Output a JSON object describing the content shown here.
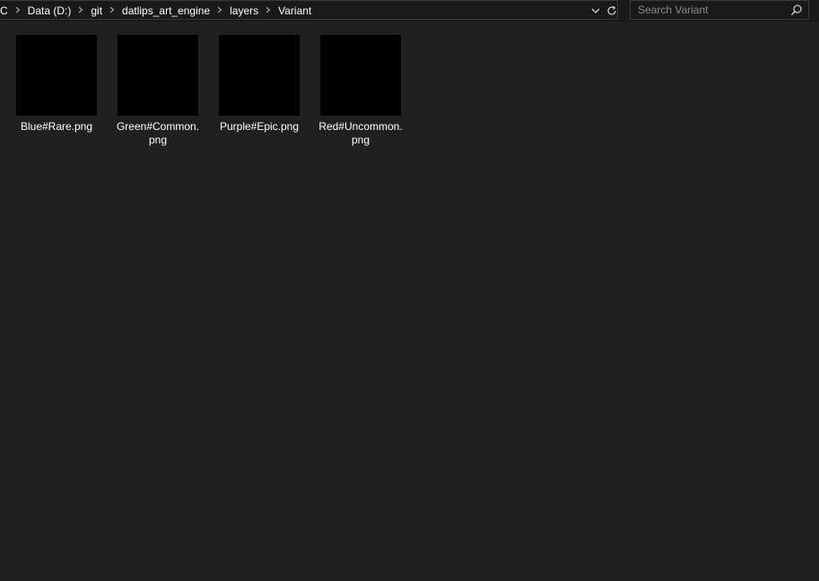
{
  "address": {
    "crumbs": [
      "C",
      "Data (D:)",
      "git",
      "datlips_art_engine",
      "layers",
      "Variant"
    ]
  },
  "search": {
    "placeholder": "Search Variant",
    "value": ""
  },
  "files": [
    {
      "name": "Blue#Rare.png"
    },
    {
      "name": "Green#Common.png"
    },
    {
      "name": "Purple#Epic.png"
    },
    {
      "name": "Red#Uncommon.png"
    }
  ],
  "icons": {
    "separator": "chevron-right-icon",
    "dropdown": "chevron-down-icon",
    "refresh": "refresh-icon",
    "search": "search-icon"
  },
  "colors": {
    "background": "#202020",
    "toolbar": "#191919",
    "thumbnail": "#000000",
    "text": "#ffffff"
  }
}
